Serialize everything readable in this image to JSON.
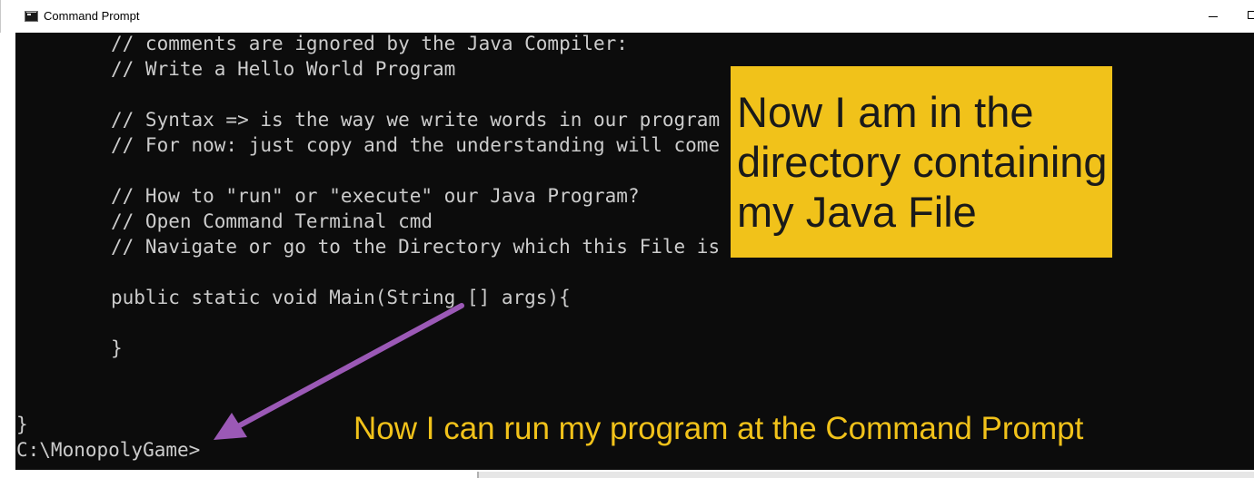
{
  "window": {
    "title": "Command Prompt",
    "icon": "cmd-icon",
    "controls": [
      "minimize",
      "maximize"
    ]
  },
  "console": {
    "code_lines": [
      "// comments are ignored by the Java Compiler:",
      "// Write a Hello World Program",
      "",
      "// Syntax => is the way we write words in our program",
      "// For now: just copy and the understanding will come",
      "",
      "// How to \"run\" or \"execute\" our Java Program?",
      "// Open Command Terminal cmd",
      "// Navigate or go to the Directory which this File is",
      "",
      "public static void Main(String [] args){",
      "",
      "}"
    ],
    "closing_brace": "}",
    "prompt": "C:\\MonopolyGame>"
  },
  "annotations": {
    "callout_text": "Now I am in the\ndirectory containing\nmy Java File",
    "caption_text": "Now I can run my program at the Command Prompt",
    "callout_color": "#f1c21a",
    "arrow_color": "#9b59b6"
  },
  "colors": {
    "console_bg": "#0c0c0c",
    "console_text": "#cccccc"
  }
}
